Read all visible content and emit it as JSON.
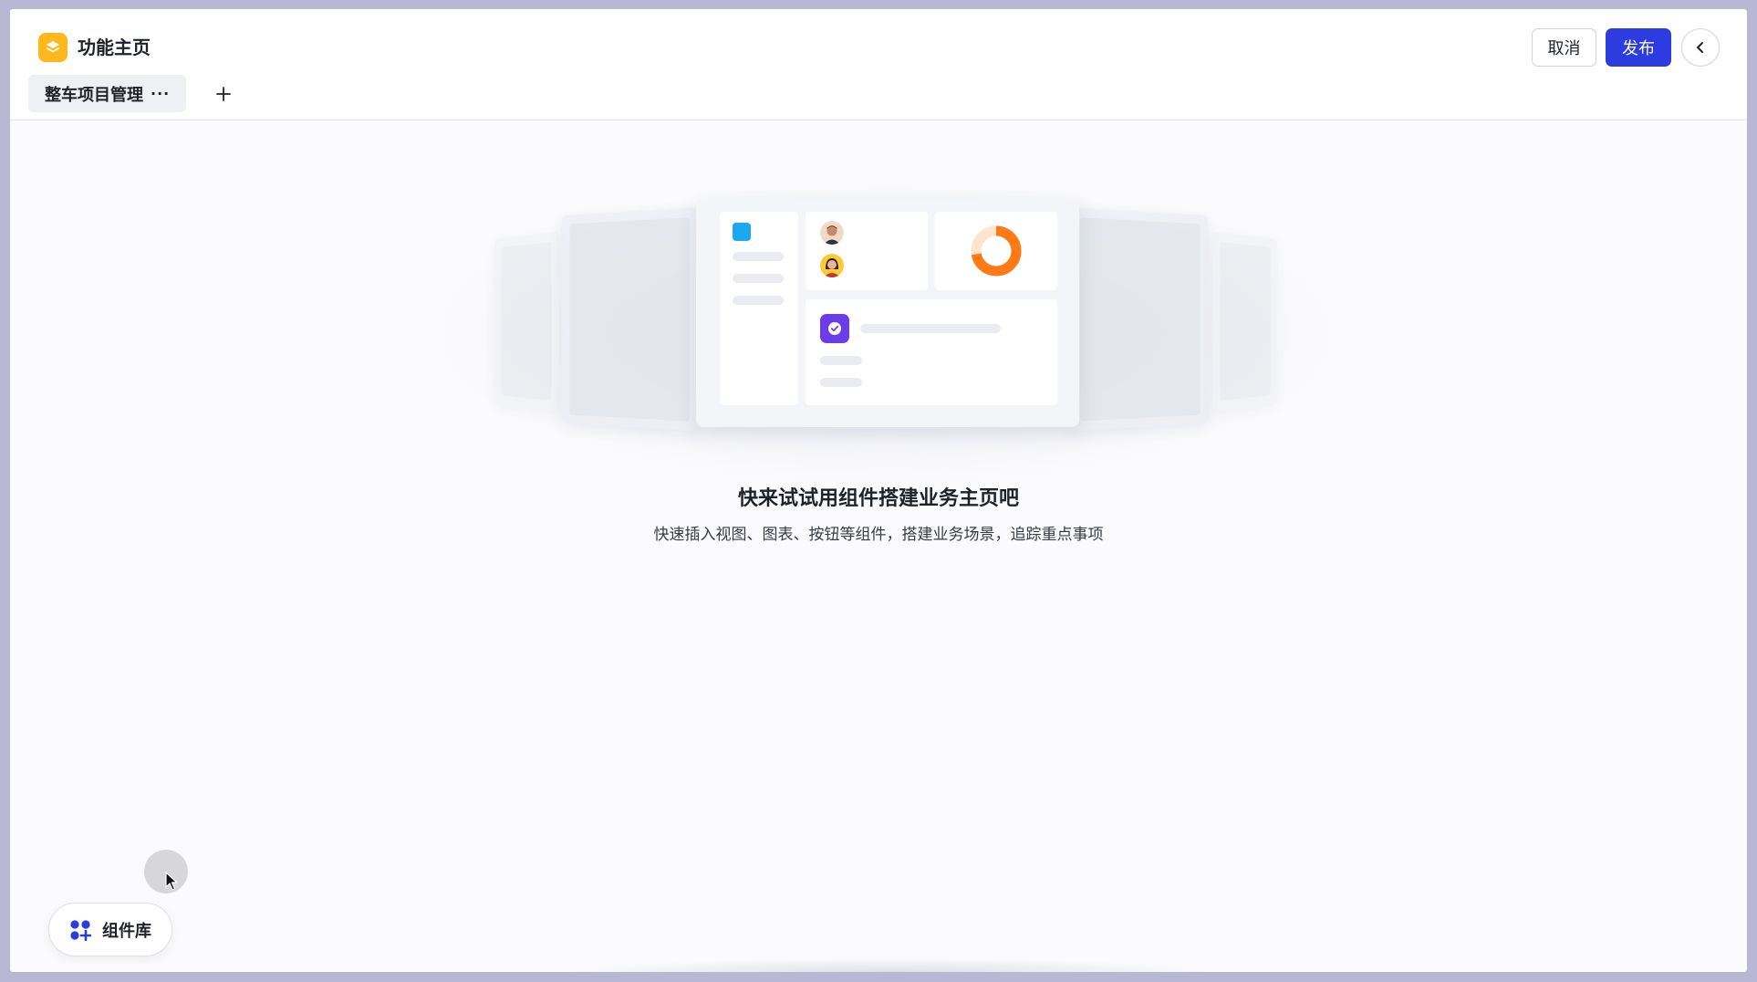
{
  "header": {
    "app_title": "功能主页",
    "tabs": [
      {
        "label": "整车项目管理",
        "more": "···"
      }
    ],
    "cancel_label": "取消",
    "publish_label": "发布"
  },
  "empty_state": {
    "title": "快来试试用组件搭建业务主页吧",
    "description": "快速插入视图、图表、按钮等组件，搭建业务场景，追踪重点事项"
  },
  "component_library": {
    "label": "组件库"
  },
  "colors": {
    "primary": "#2c3cdf",
    "app_icon": "#ffb81c",
    "donut": "#ff7a14",
    "task_icon": "#6a3de8",
    "sidebar_square": "#1aa9f0"
  },
  "icons": {
    "app": "layers-icon",
    "add_tab": "plus-icon",
    "back": "chevron-left-icon",
    "library": "apps-grid-plus-icon"
  }
}
